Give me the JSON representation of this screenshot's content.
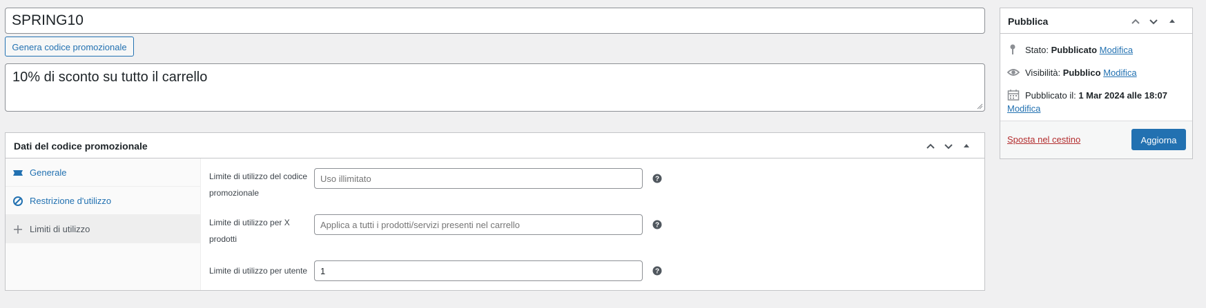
{
  "coupon": {
    "code": "SPRING10",
    "generate_button": "Genera codice promozionale",
    "description": "10% di sconto su tutto il carrello"
  },
  "coupon_data": {
    "title": "Dati del codice promozionale",
    "tabs": [
      {
        "label": "Generale",
        "icon": "ticket-icon"
      },
      {
        "label": "Restrizione d'utilizzo",
        "icon": "block-icon"
      },
      {
        "label": "Limiti di utilizzo",
        "icon": "plus-icon"
      }
    ],
    "fields": [
      {
        "label_line1": "Limite di utilizzo del codice",
        "label_line2": "promozionale",
        "placeholder": "Uso illimitato",
        "value": ""
      },
      {
        "label_line1": "Limite di utilizzo per X",
        "label_line2": "prodotti",
        "placeholder": "Applica a tutti i prodotti/servizi presenti nel carrello",
        "value": ""
      },
      {
        "label_line1": "Limite di utilizzo per utente",
        "label_line2": "",
        "placeholder": "",
        "value": "1"
      }
    ]
  },
  "publish": {
    "title": "Pubblica",
    "status_label": "Stato:",
    "status_value": "Pubblicato",
    "visibility_label": "Visibilità:",
    "visibility_value": "Pubblico",
    "published_label": "Pubblicato il:",
    "published_value": "1 Mar 2024 alle 18:07",
    "edit_link": "Modifica",
    "trash_link": "Sposta nel cestino",
    "update_button": "Aggiorna"
  },
  "colors": {
    "accent": "#2271b1",
    "danger": "#b32d2e",
    "background": "#f0f0f1"
  }
}
